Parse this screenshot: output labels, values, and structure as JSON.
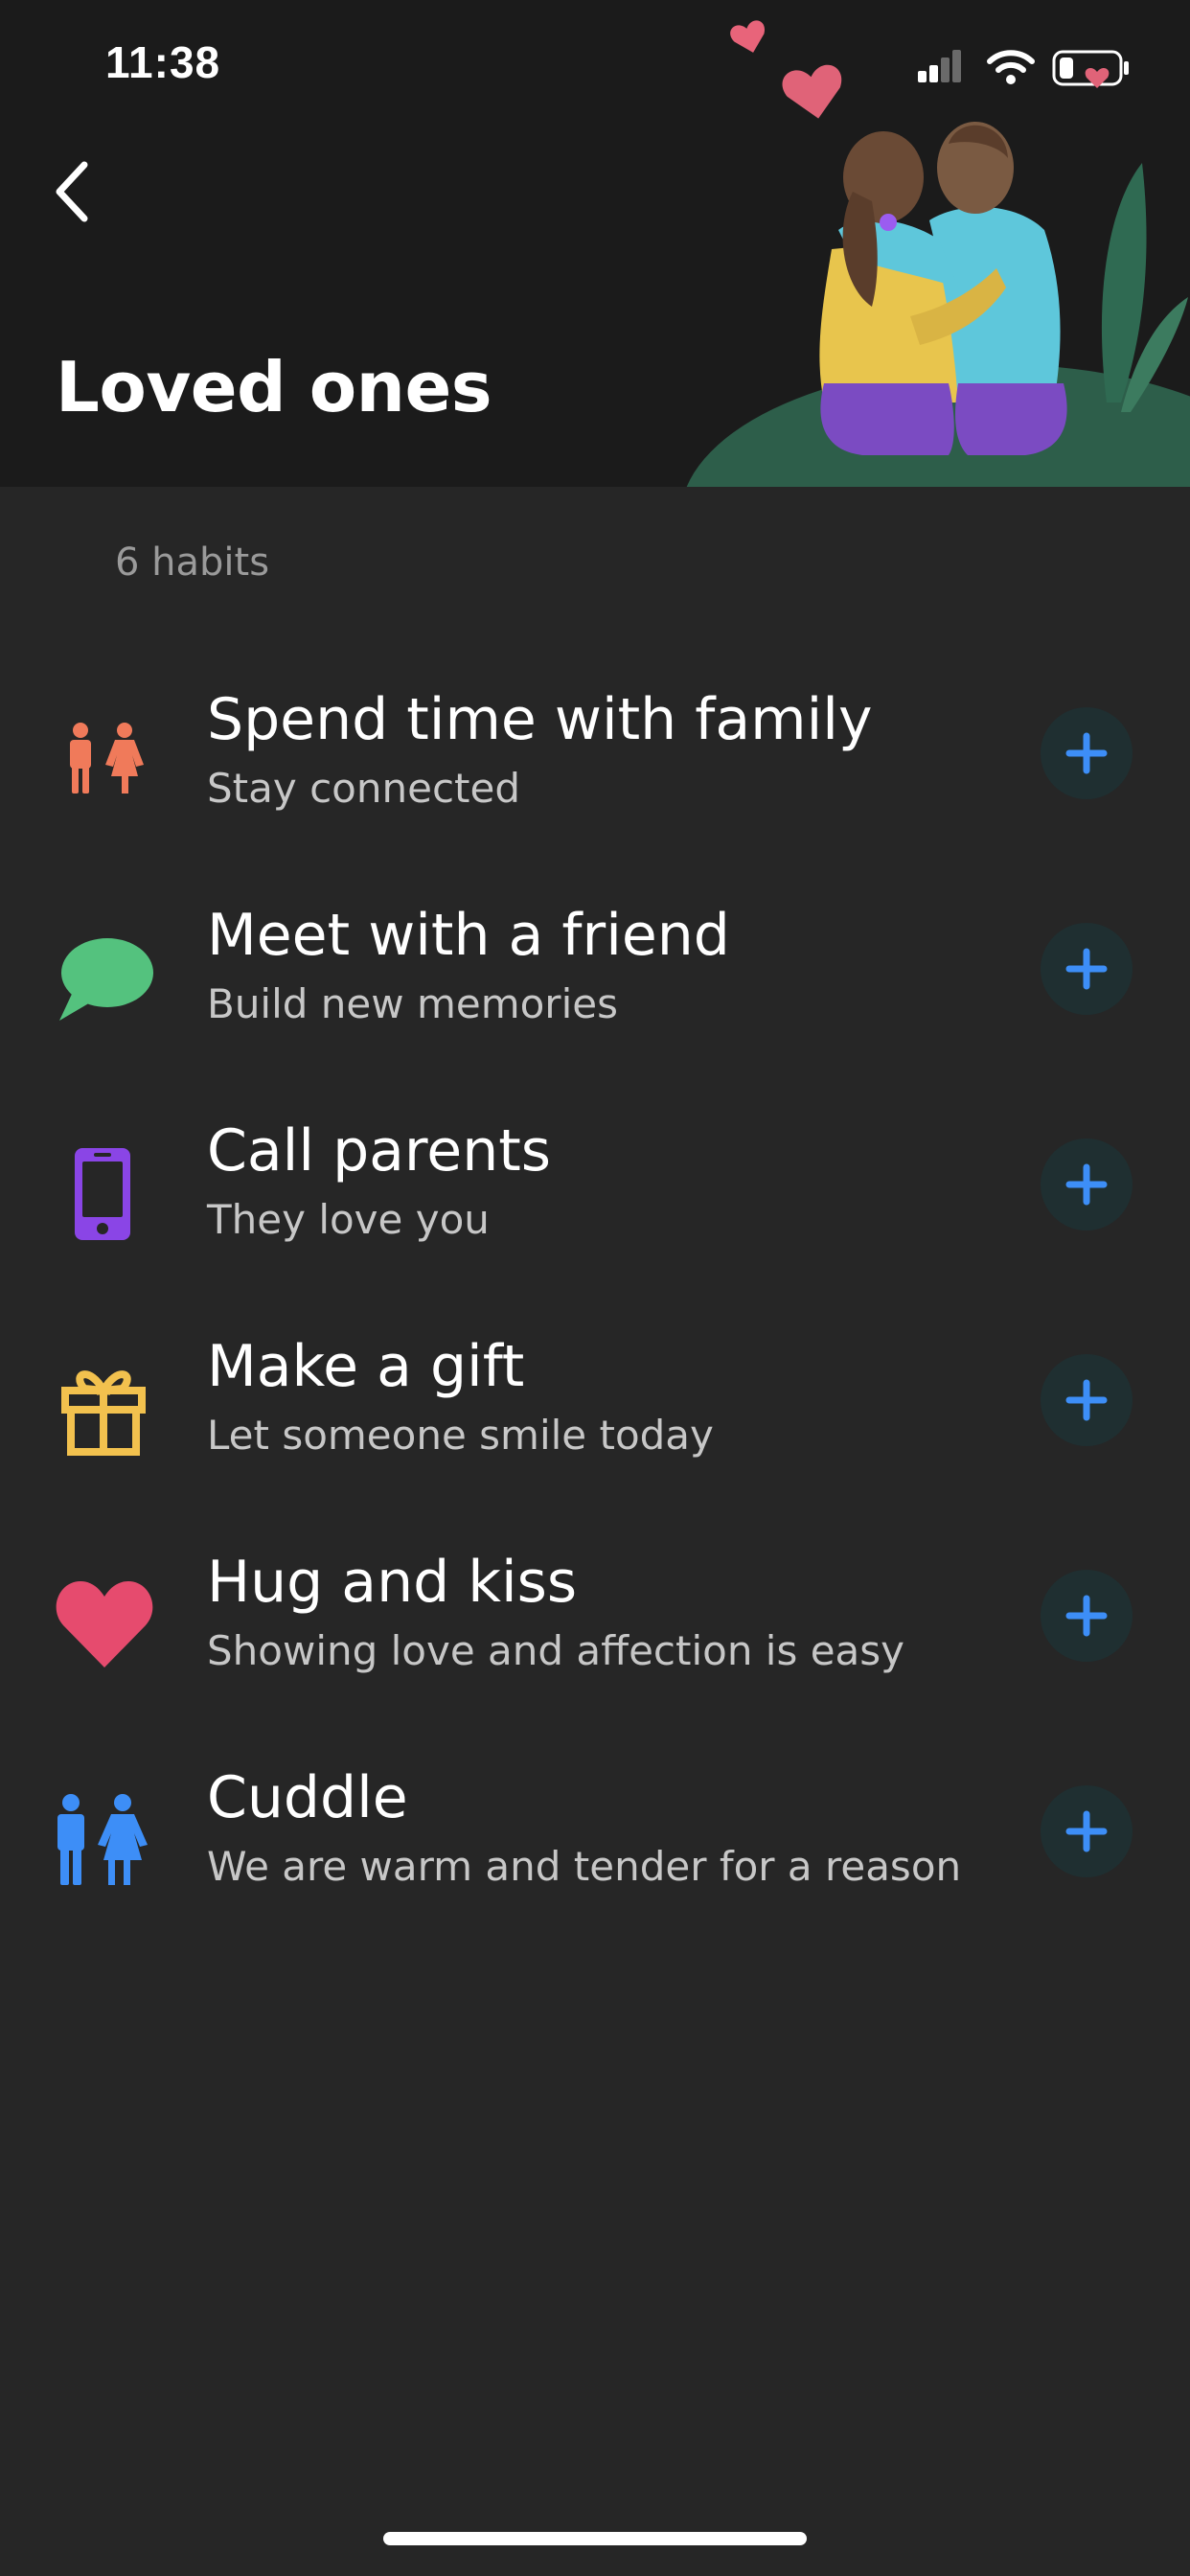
{
  "status_bar": {
    "time": "11:38",
    "icons": [
      "cellular-signal-icon",
      "wifi-icon",
      "battery-icon"
    ]
  },
  "header": {
    "back_icon": "chevron-left-icon",
    "title": "Loved ones",
    "illustration": "couple-hugging-illustration"
  },
  "habit_count": "6 habits",
  "colors": {
    "background": "#262626",
    "header_background": "#1b1b1b",
    "add_button_bg": "#1f2f31",
    "add_button_plus": "#3d8ef7"
  },
  "habits": [
    {
      "title": "Spend time with family",
      "subtitle": "Stay connected",
      "icon": "family-icon",
      "color": "#f07a5a"
    },
    {
      "title": "Meet with a friend",
      "subtitle": "Build new memories",
      "icon": "speech-bubble-icon",
      "color": "#54c27e"
    },
    {
      "title": "Call parents",
      "subtitle": "They love you",
      "icon": "phone-icon",
      "color": "#8a45e6"
    },
    {
      "title": "Make a gift",
      "subtitle": "Let someone smile today",
      "icon": "gift-icon",
      "color": "#f2c14e"
    },
    {
      "title": "Hug and kiss",
      "subtitle": "Showing love and affection is easy",
      "icon": "heart-icon",
      "color": "#e64b6e"
    },
    {
      "title": "Cuddle",
      "subtitle": "We are warm and tender for a reason",
      "icon": "couple-icon",
      "color": "#3d8ef7"
    }
  ]
}
